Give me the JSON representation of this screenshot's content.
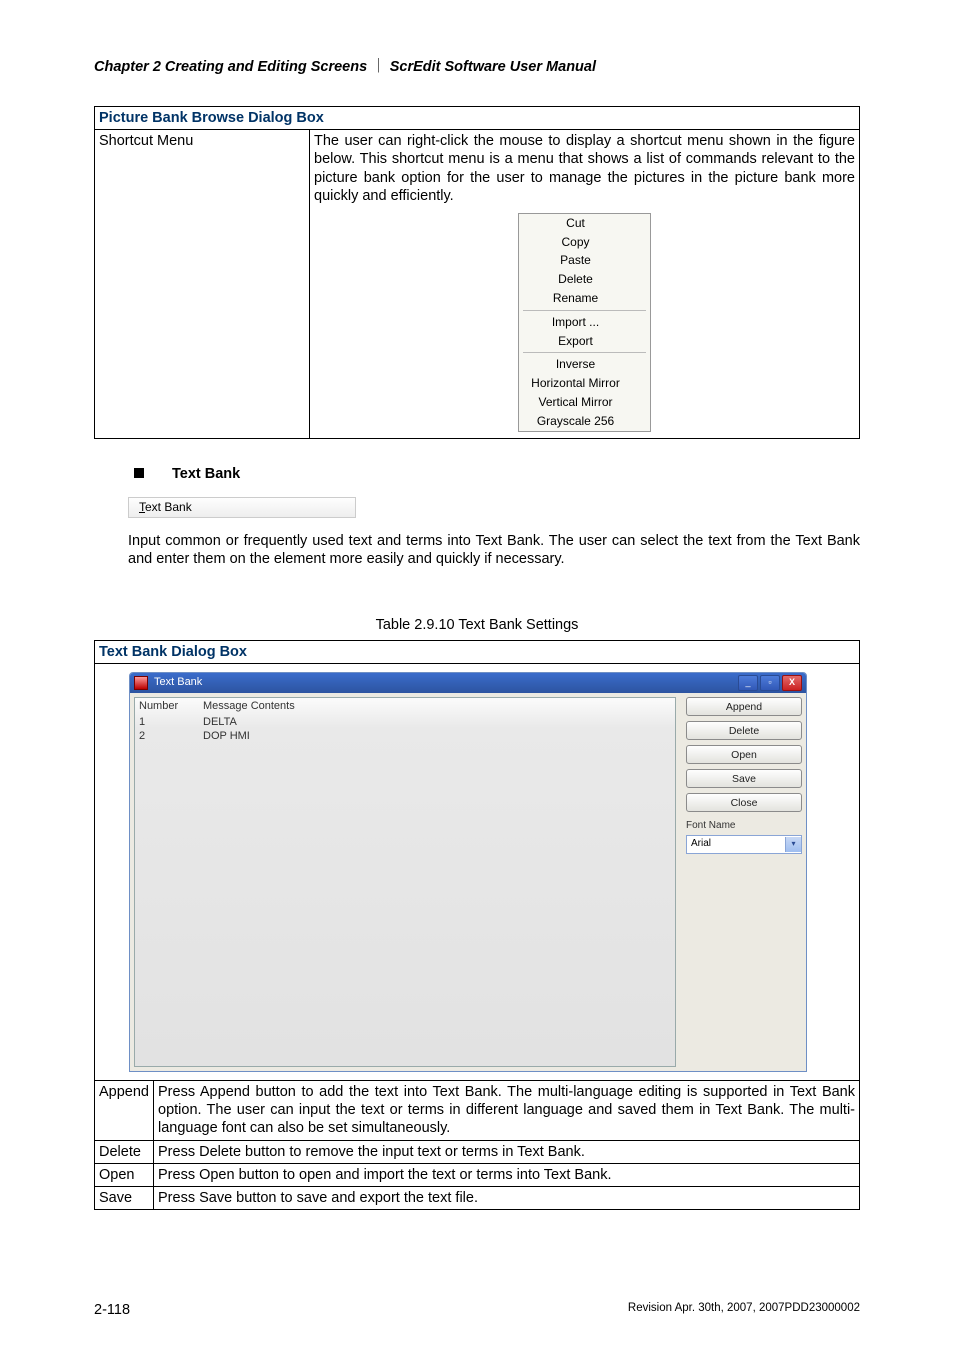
{
  "header": {
    "chapter": "Chapter 2  Creating and Editing Screens",
    "sep": "｜",
    "manual": "ScrEdit Software User Manual"
  },
  "pictureBankTable": {
    "title": "Picture Bank Browse Dialog Box",
    "rowLabel": "Shortcut Menu",
    "rowText": "The user can right-click the mouse to display a shortcut menu shown in the figure below. This shortcut menu is a menu that shows a list of commands relevant to the picture bank option for the user to manage the pictures in the picture bank more quickly and efficiently."
  },
  "contextMenu": {
    "g1": [
      "Cut",
      "Copy",
      "Paste",
      "Delete",
      "Rename"
    ],
    "g2": [
      "Import ...",
      "Export"
    ],
    "g3": [
      "Inverse",
      "Horizontal Mirror",
      "Vertical Mirror",
      "Grayscale 256"
    ]
  },
  "textBankSection": {
    "heading": "Text Bank",
    "menuLabelPrefix": "T",
    "menuLabelRest": "ext Bank",
    "paragraph": "Input common or frequently used text and terms into Text Bank. The user can select the text from the Text Bank and enter them on the element more easily and quickly if necessary."
  },
  "tableCaption": "Table 2.9.10 Text Bank Settings",
  "textBankTable": {
    "title": "Text Bank Dialog Box"
  },
  "dialog": {
    "title": "Text Bank",
    "cols": {
      "number": "Number",
      "contents": "Message Contents"
    },
    "rows": [
      {
        "num": "1",
        "msg": "DELTA"
      },
      {
        "num": "2",
        "msg": "DOP HMI"
      }
    ],
    "buttons": {
      "append": "Append",
      "delete": "Delete",
      "open": "Open",
      "save": "Save",
      "close": "Close"
    },
    "fontLabel": "Font Name",
    "fontValue": "Arial",
    "caps": {
      "min": "_",
      "max": "▫",
      "close": "X"
    }
  },
  "descRows": {
    "append": {
      "label": "Append",
      "text": "Press Append button to add the text into Text Bank. The multi-language editing is supported in Text Bank option. The user can input the text or terms in different language and saved them in Text Bank. The multi-language font can also be set simultaneously."
    },
    "delete": {
      "label": "Delete",
      "text": "Press Delete button to remove the input text or terms in Text Bank."
    },
    "open": {
      "label": "Open",
      "text": "Press Open button to open and import the text or terms into Text Bank."
    },
    "save": {
      "label": "Save",
      "text": "Press Save button to save and export the text file."
    }
  },
  "footer": {
    "page": "2-118",
    "rev": "Revision Apr. 30th, 2007, 2007PDD23000002"
  }
}
